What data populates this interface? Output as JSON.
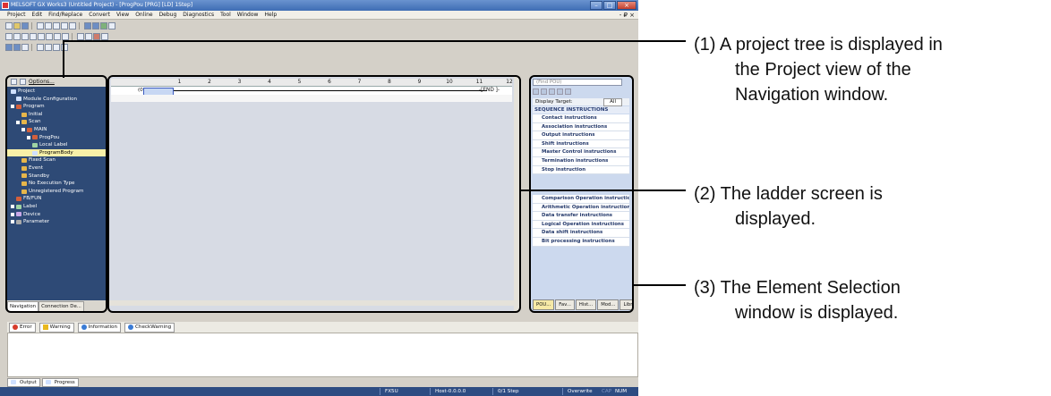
{
  "window": {
    "title": "MELSOFT GX Works3 (Untitled Project) - [ProgPou [PRG] [LD] 1Step]",
    "buttons": [
      "–",
      "□",
      "×"
    ]
  },
  "menu": {
    "items": [
      "Project",
      "Edit",
      "Find/Replace",
      "Convert",
      "View",
      "Online",
      "Debug",
      "Diagnostics",
      "Tool",
      "Window",
      "Help"
    ],
    "mdi_controls": "- ₽ ×"
  },
  "navigation": {
    "toolbar_options": "Options...",
    "tree": [
      {
        "label": "Project",
        "icon": "doc",
        "indent": 0,
        "exp": false
      },
      {
        "label": "Module Configuration",
        "icon": "doc",
        "indent": 1,
        "exp": false
      },
      {
        "label": "Program",
        "icon": "prog",
        "indent": 0,
        "exp": true
      },
      {
        "label": "Initial",
        "icon": "folder",
        "indent": 2,
        "exp": false
      },
      {
        "label": "Scan",
        "icon": "folder",
        "indent": 1,
        "exp": true
      },
      {
        "label": "MAIN",
        "icon": "prog",
        "indent": 2,
        "exp": true
      },
      {
        "label": "ProgPou",
        "icon": "prog",
        "indent": 3,
        "exp": true
      },
      {
        "label": "Local Label",
        "icon": "lbl",
        "indent": 4,
        "exp": false
      },
      {
        "label": "ProgramBody",
        "icon": "doc",
        "indent": 4,
        "exp": false,
        "selected": true
      },
      {
        "label": "Fixed Scan",
        "icon": "folder",
        "indent": 2,
        "exp": false
      },
      {
        "label": "Event",
        "icon": "folder",
        "indent": 2,
        "exp": false
      },
      {
        "label": "Standby",
        "icon": "folder",
        "indent": 2,
        "exp": false
      },
      {
        "label": "No Execution Type",
        "icon": "folder",
        "indent": 2,
        "exp": false
      },
      {
        "label": "Unregistered Program",
        "icon": "folder",
        "indent": 2,
        "exp": false
      },
      {
        "label": "FB/FUN",
        "icon": "prog",
        "indent": 1,
        "exp": false
      },
      {
        "label": "Label",
        "icon": "lbl",
        "indent": 0,
        "exp": true
      },
      {
        "label": "Device",
        "icon": "dev",
        "indent": 0,
        "exp": true
      },
      {
        "label": "Parameter",
        "icon": "par",
        "indent": 0,
        "exp": true
      }
    ],
    "tabs": [
      "Navigation",
      "Connection De..."
    ]
  },
  "ladder": {
    "columns": [
      "1",
      "2",
      "3",
      "4",
      "5",
      "6",
      "7",
      "8",
      "9",
      "10",
      "11",
      "12"
    ],
    "row_label": "(0)",
    "end_label": "-[END ]-"
  },
  "element_selection": {
    "search_placeholder": "(Find POU)",
    "display_target_label": "Display Target:",
    "display_target_value": "All",
    "category": "SEQUENCE INSTRUCTIONS",
    "items_a": [
      "Contact instructions",
      "Association instructions",
      "Output instructions",
      "Shift instructions",
      "Master Control instructions",
      "Termination instructions",
      "Stop instruction"
    ],
    "items_b": [
      "Comparison Operation instructio",
      "Arithmetic Operation instruction",
      "Data transfer instructions",
      "Logical Operation instructions",
      "Data shift instructions",
      "Bit processing instructions"
    ],
    "tabs": [
      "POU...",
      "Fav...",
      "Hist...",
      "Mod...",
      "Libr..."
    ]
  },
  "output": {
    "tabs": [
      "Error",
      "Warning",
      "Information",
      "CheckWarning"
    ],
    "bottom_tabs": [
      "Output",
      "Progress"
    ]
  },
  "statusbar": {
    "cpu": "FX5U",
    "host": "Host-0.0.0.0",
    "step": "0/1 Step",
    "mode": "Overwrite",
    "caps": "CAP",
    "num": "NUM"
  },
  "callouts": [
    {
      "line1": "(1) A project tree is displayed in",
      "line2": "the Project view of the",
      "line3": "Navigation window."
    },
    {
      "line1": "(2) The ladder screen is",
      "line2": "displayed."
    },
    {
      "line1": "(3) The Element Selection",
      "line2": "window is displayed."
    }
  ],
  "colors": {
    "navigation_bg": "#2e4a76",
    "statusbar_bg": "#2d4c82",
    "selection_highlight": "#f8f0a8",
    "element_category": "#253a72"
  }
}
